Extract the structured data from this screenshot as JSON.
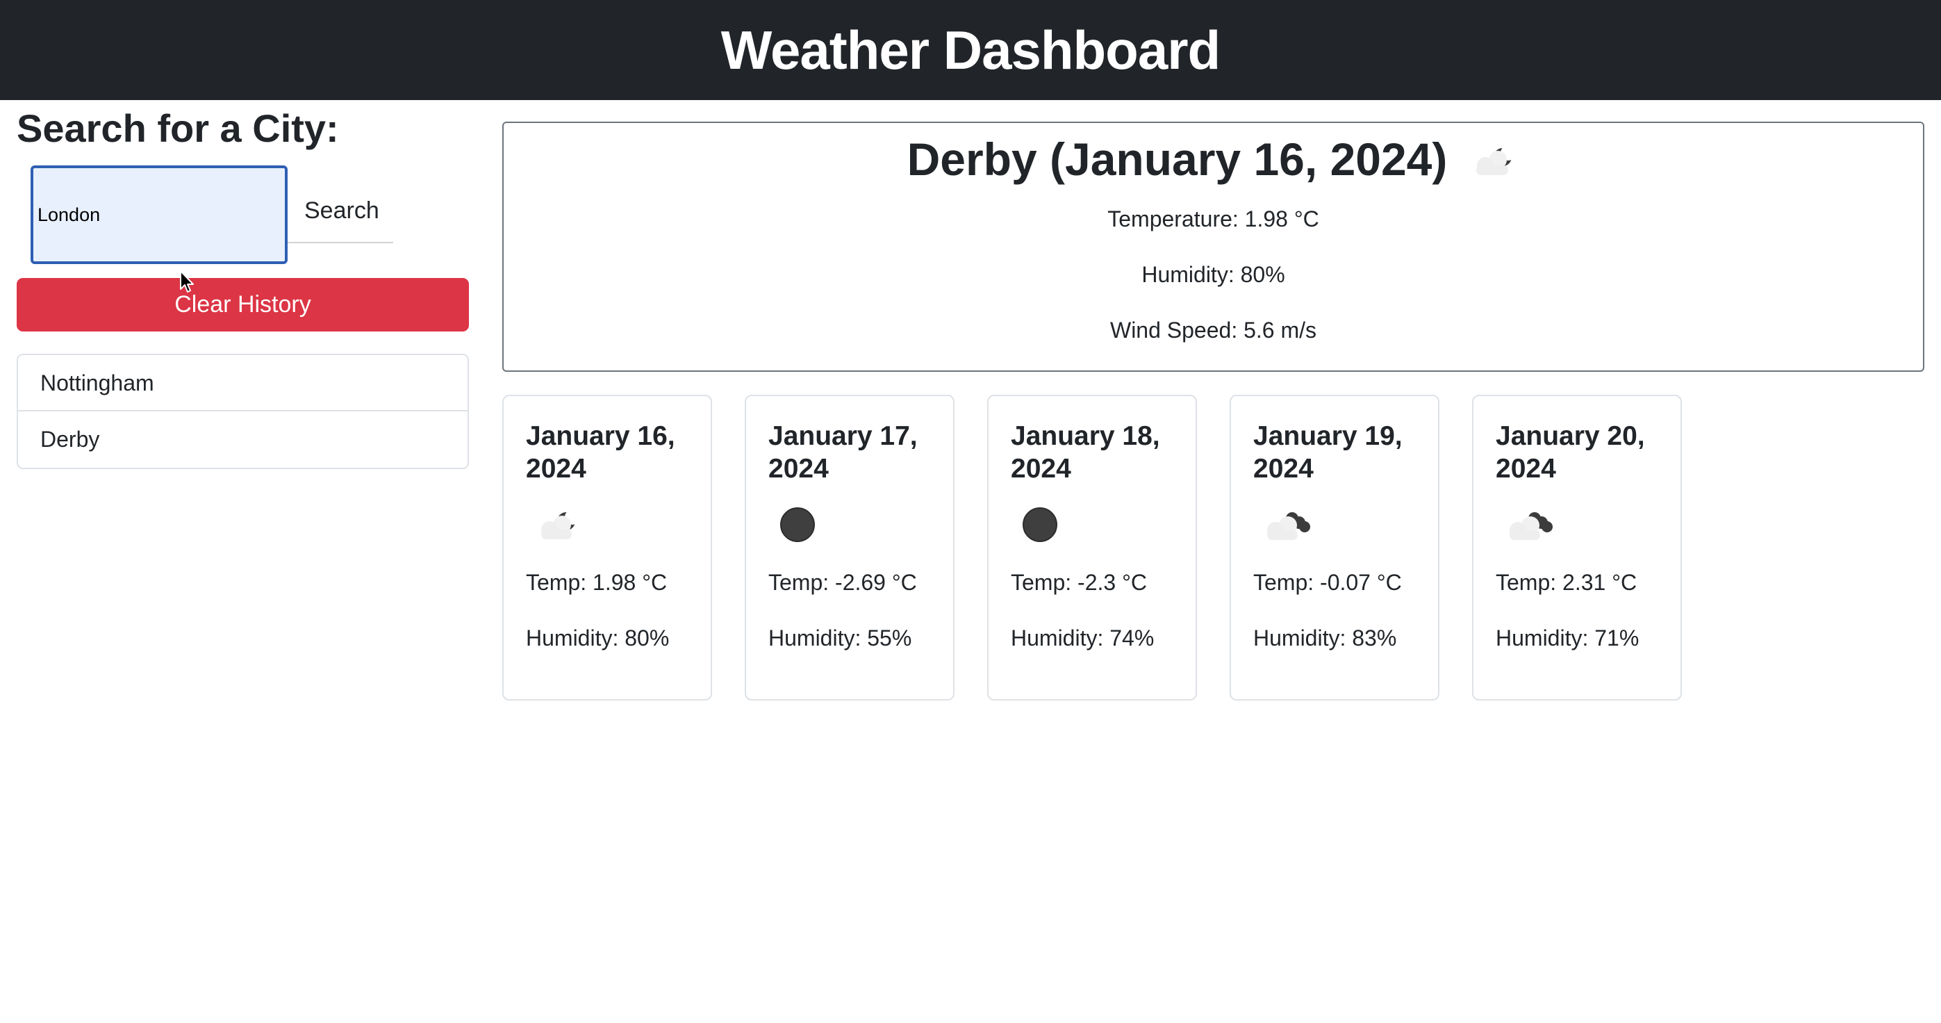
{
  "header": {
    "title": "Weather Dashboard"
  },
  "search": {
    "heading": "Search for a City:",
    "input_value": "London",
    "button_label": "Search",
    "clear_label": "Clear History"
  },
  "history": [
    "Nottingham",
    "Derby"
  ],
  "current": {
    "title": "Derby (January 16, 2024)",
    "icon": "cloud-moon-icon",
    "temperature": "Temperature: 1.98 °C",
    "humidity": "Humidity: 80%",
    "wind": "Wind Speed: 5.6 m/s"
  },
  "forecast": [
    {
      "date": "January 16, 2024",
      "icon": "cloud-moon-icon",
      "temp": "Temp: 1.98 °C",
      "humidity": "Humidity: 80%"
    },
    {
      "date": "January 17, 2024",
      "icon": "moon-icon",
      "temp": "Temp: -2.69 °C",
      "humidity": "Humidity: 55%"
    },
    {
      "date": "January 18, 2024",
      "icon": "moon-icon",
      "temp": "Temp: -2.3 °C",
      "humidity": "Humidity: 74%"
    },
    {
      "date": "January 19, 2024",
      "icon": "broken-clouds-icon",
      "temp": "Temp: -0.07 °C",
      "humidity": "Humidity: 83%"
    },
    {
      "date": "January 20, 2024",
      "icon": "broken-clouds-icon",
      "temp": "Temp: 2.31 °C",
      "humidity": "Humidity: 71%"
    }
  ],
  "colors": {
    "header_bg": "#212529",
    "danger": "#dc3545",
    "input_bg": "#e8f0fe",
    "input_border": "#2f5fb3"
  }
}
